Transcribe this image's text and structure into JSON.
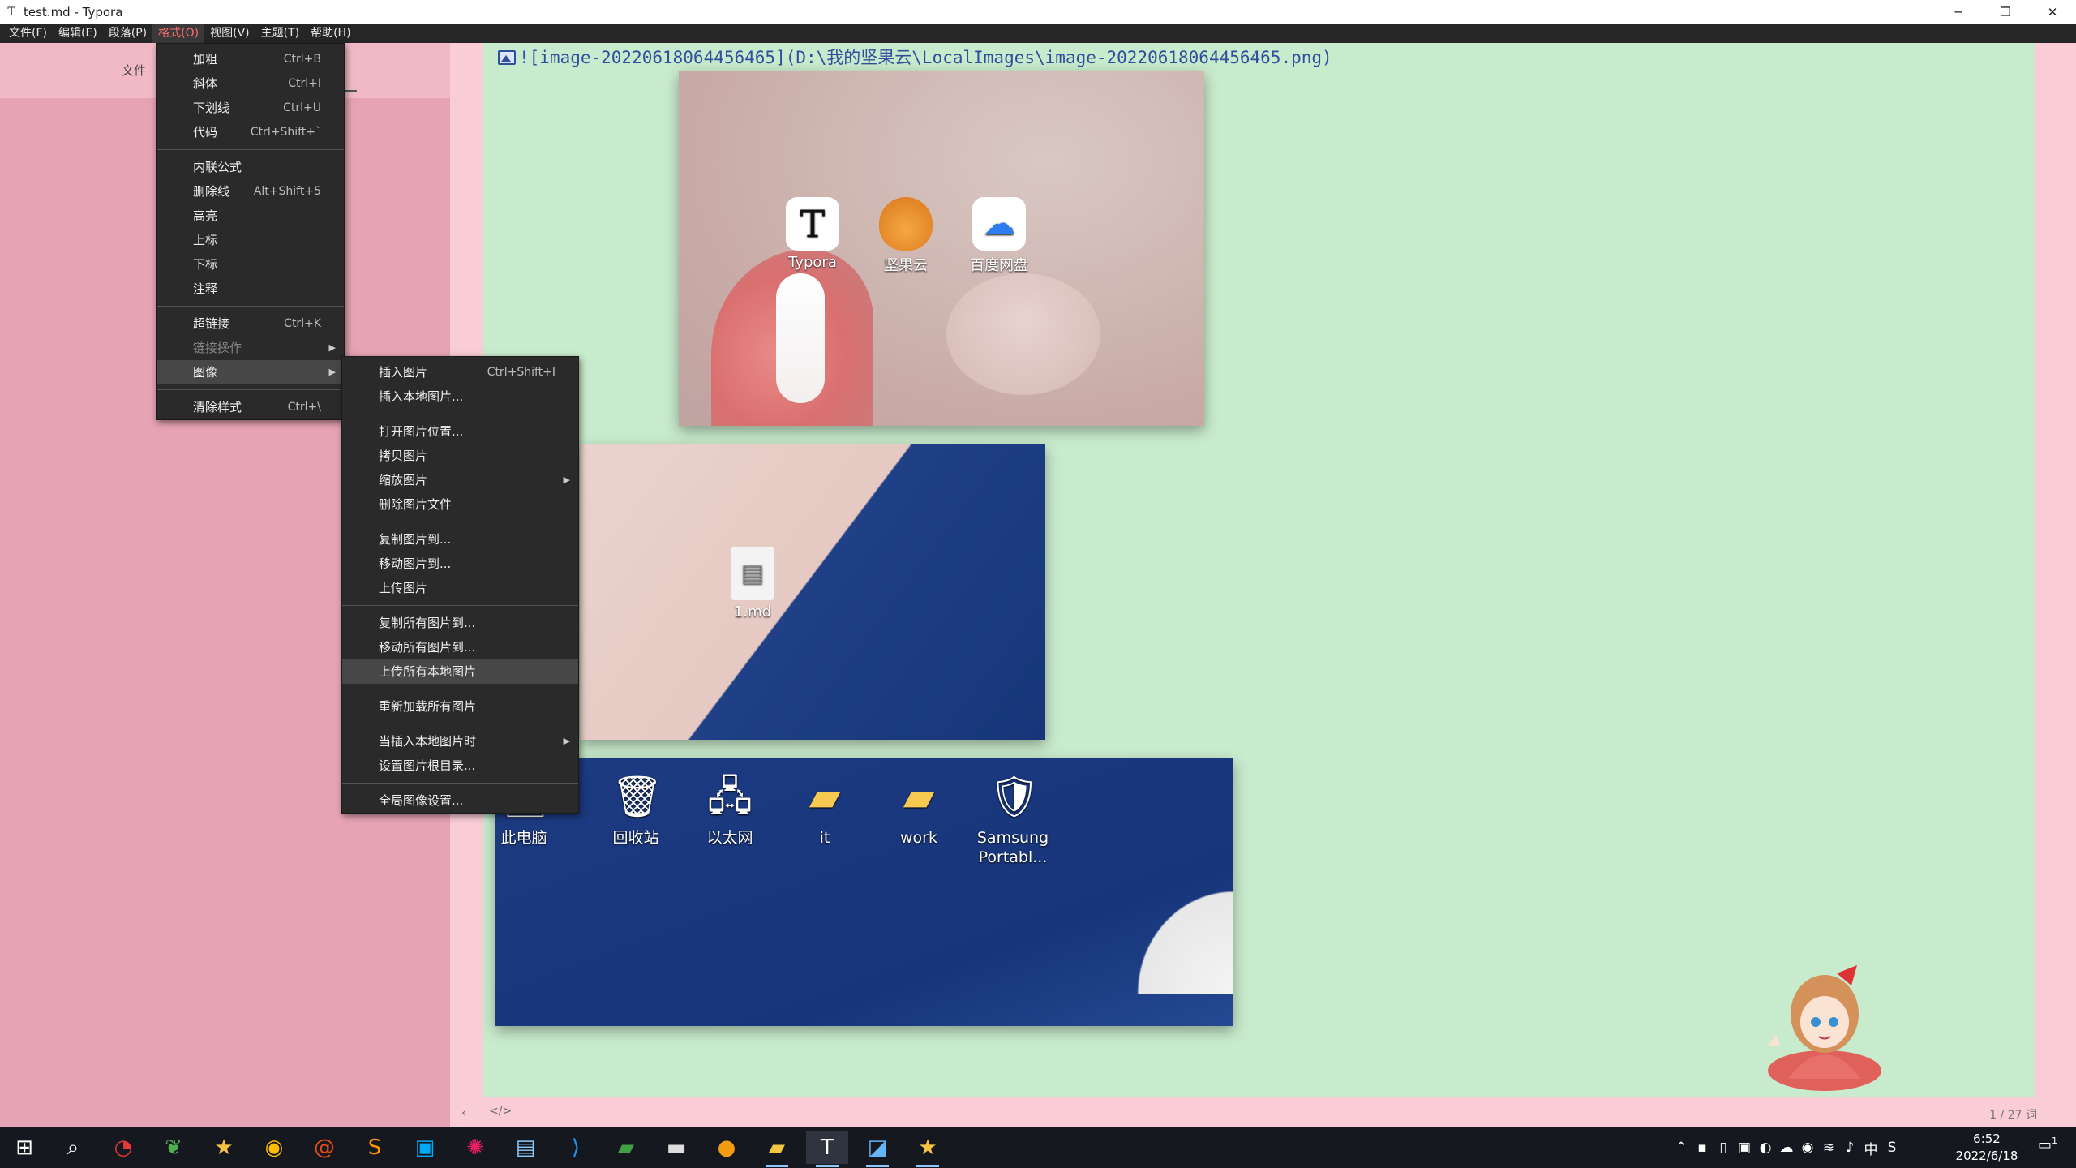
{
  "window": {
    "app_icon": "T",
    "title": "test.md - Typora",
    "minimize_icon": "─",
    "restore_icon": "❐",
    "close_icon": "✕"
  },
  "menubar": [
    "文件(F)",
    "编辑(E)",
    "段落(P)",
    "格式(O)",
    "视图(V)",
    "主题(T)",
    "帮助(H)"
  ],
  "sidebar": {
    "label": "文件"
  },
  "editor": {
    "markdown_line": "![image-20220618064456465](D:\\我的坚果云\\LocalImages\\image-20220618064456465.png)"
  },
  "format_menu": [
    {
      "label": "加粗",
      "shortcut": "Ctrl+B"
    },
    {
      "label": "斜体",
      "shortcut": "Ctrl+I"
    },
    {
      "label": "下划线",
      "shortcut": "Ctrl+U"
    },
    {
      "label": "代码",
      "shortcut": "Ctrl+Shift+`"
    },
    {
      "label": "内联公式",
      "shortcut": ""
    },
    {
      "label": "删除线",
      "shortcut": "Alt+Shift+5"
    },
    {
      "label": "高亮",
      "shortcut": ""
    },
    {
      "label": "上标",
      "shortcut": ""
    },
    {
      "label": "下标",
      "shortcut": ""
    },
    {
      "label": "注释",
      "shortcut": ""
    },
    {
      "label": "超链接",
      "shortcut": "Ctrl+K"
    },
    {
      "label": "链接操作",
      "shortcut": ""
    },
    {
      "label": "图像",
      "shortcut": ""
    },
    {
      "label": "清除样式",
      "shortcut": "Ctrl+\\"
    }
  ],
  "image_menu": [
    {
      "label": "插入图片",
      "shortcut": "Ctrl+Shift+I"
    },
    {
      "label": "插入本地图片...",
      "shortcut": ""
    },
    {
      "label": "打开图片位置...",
      "shortcut": ""
    },
    {
      "label": "拷贝图片",
      "shortcut": ""
    },
    {
      "label": "缩放图片",
      "shortcut": ""
    },
    {
      "label": "删除图片文件",
      "shortcut": ""
    },
    {
      "label": "复制图片到...",
      "shortcut": ""
    },
    {
      "label": "移动图片到...",
      "shortcut": ""
    },
    {
      "label": "上传图片",
      "shortcut": ""
    },
    {
      "label": "复制所有图片到...",
      "shortcut": ""
    },
    {
      "label": "移动所有图片到...",
      "shortcut": ""
    },
    {
      "label": "上传所有本地图片",
      "shortcut": ""
    },
    {
      "label": "重新加载所有图片",
      "shortcut": ""
    },
    {
      "label": "当插入本地图片时",
      "shortcut": ""
    },
    {
      "label": "设置图片根目录...",
      "shortcut": ""
    },
    {
      "label": "全局图像设置...",
      "shortcut": ""
    }
  ],
  "image1_icons": [
    "Typora",
    "坚果云",
    "百度网盘"
  ],
  "image2_icon": "1.md",
  "image3_icons": [
    "此电脑",
    "回收站",
    "以太网",
    "it",
    "work",
    "Samsung Portabl..."
  ],
  "statusbar": {
    "back_icon": "‹",
    "source_icon": "</>",
    "word_count": "1 / 27 词"
  },
  "tray": {
    "ime": "中",
    "time": "6:52",
    "date": "2022/6/18",
    "notification_count": "1"
  },
  "colors": {
    "accent_menu": "#ff6d6d",
    "editor_bg": "#c9ebcd",
    "sidebar_bg": "#e6a3b4"
  }
}
